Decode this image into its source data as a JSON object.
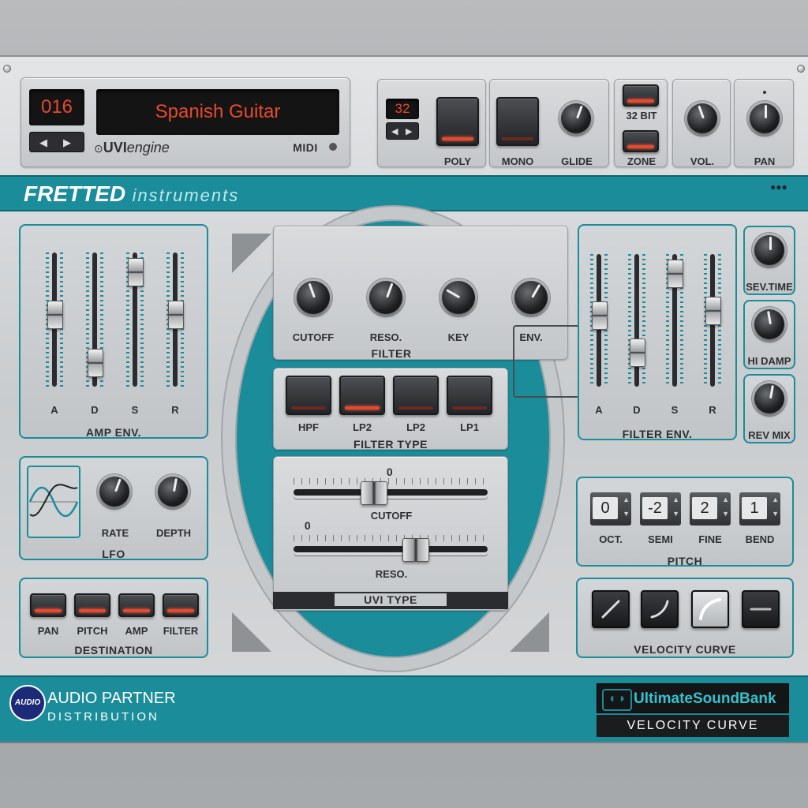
{
  "header": {
    "preset_number": "016",
    "preset_name": "Spanish Guitar",
    "engine_prefix": "UVI",
    "engine_suffix": "engine",
    "midi_label": "MIDI",
    "voices": "32",
    "poly_label": "POLY",
    "mono_label": "MONO",
    "glide_label": "GLIDE",
    "bit_label": "32 BIT",
    "zone_label": "ZONE",
    "vol_label": "VOL.",
    "pan_label": "PAN"
  },
  "banner": {
    "title_bold": "FRETTED",
    "title_light": "instruments"
  },
  "amp_env": {
    "title": "AMP ENV.",
    "faders": [
      {
        "label": "A",
        "level": 0.55
      },
      {
        "label": "D",
        "level": 0.1
      },
      {
        "label": "S",
        "level": 0.95
      },
      {
        "label": "R",
        "level": 0.55
      }
    ]
  },
  "filter": {
    "title": "FILTER",
    "knobs": [
      {
        "label": "CUTOFF",
        "angle": 160
      },
      {
        "label": "RESO.",
        "angle": 200
      },
      {
        "label": "KEY",
        "angle": 120
      },
      {
        "label": "ENV.",
        "angle": 210
      }
    ]
  },
  "filter_type": {
    "title": "FILTER TYPE",
    "buttons": [
      {
        "label": "HPF",
        "on": false
      },
      {
        "label": "LP2",
        "on": true
      },
      {
        "label": "LP2",
        "on": false
      },
      {
        "label": "LP1",
        "on": false
      }
    ]
  },
  "uvi_type": {
    "title": "UVI TYPE",
    "cutoff_label": "CUTOFF",
    "cutoff_value": "0",
    "cutoff_level": 0.4,
    "reso_label": "RESO.",
    "reso_value": "0",
    "reso_level": 0.65
  },
  "filter_env": {
    "title": "FILTER ENV.",
    "faders": [
      {
        "label": "A",
        "level": 0.55
      },
      {
        "label": "D",
        "level": 0.2
      },
      {
        "label": "S",
        "level": 0.95
      },
      {
        "label": "R",
        "level": 0.6
      }
    ]
  },
  "reverb": {
    "knobs": [
      {
        "label": "SEV.TIME",
        "angle": 180
      },
      {
        "label": "HI DAMP",
        "angle": 170
      },
      {
        "label": "REV MIX",
        "angle": 190
      }
    ]
  },
  "lfo": {
    "title": "LFO",
    "rate_label": "RATE",
    "depth_label": "DEPTH"
  },
  "destination": {
    "title": "DESTINATION",
    "buttons": [
      {
        "label": "PAN"
      },
      {
        "label": "PITCH"
      },
      {
        "label": "AMP"
      },
      {
        "label": "FILTER"
      }
    ]
  },
  "pitch": {
    "title": "PITCH",
    "boxes": [
      {
        "label": "OCT.",
        "value": "0"
      },
      {
        "label": "SEMI",
        "value": "-2"
      },
      {
        "label": "FINE",
        "value": "2"
      },
      {
        "label": "BEND",
        "value": "1"
      }
    ]
  },
  "velocity": {
    "title": "VELOCITY CURVE"
  },
  "footer": {
    "logo_badge": "AUDIO",
    "partner_line1": "AUDIO PARTNER",
    "partner_line2": "DISTRIBUTION",
    "brand": "UltimateSoundBank",
    "brand_caption": "VELOCITY CURVE"
  },
  "colors": {
    "accent": "#1b8c9a",
    "led": "#e8492d",
    "panel": "#cfd2d4"
  }
}
